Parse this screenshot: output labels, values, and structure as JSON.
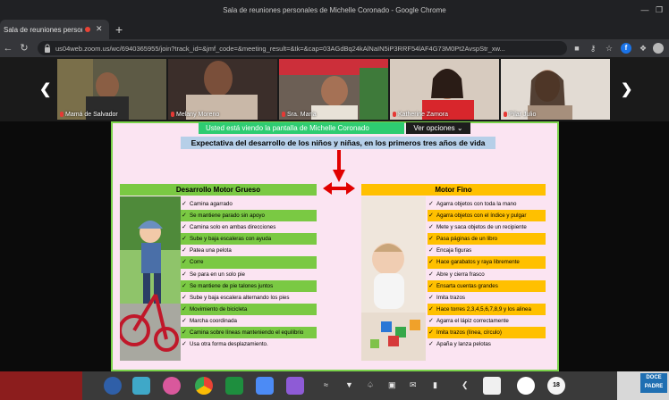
{
  "window": {
    "title": "Sala de reuniones personales de Michelle Coronado - Google Chrome",
    "minimize_icon": "minimize-icon",
    "restore_icon": "restore-icon"
  },
  "tabs": [
    {
      "label": "Sala de reuniones personal",
      "active": true,
      "recording_color": "#ea4335"
    }
  ],
  "new_tab_label": "+",
  "address": {
    "url": "us04web.zoom.us/wc/6940365955/join?track_id=&jmf_code=&meeting_result=&tk=&cap=03AGdBq24kAlNaIN5iP3RRF54lAF4G73M0Pt2AvspStr_xw..."
  },
  "participants": [
    {
      "name": "Mamá de Salvador",
      "muted": true,
      "bg": "#6e6a52"
    },
    {
      "name": "Melany Moreno",
      "muted": true,
      "bg": "#4a3a35"
    },
    {
      "name": "Sra. María",
      "muted": true,
      "bg": "#7a6a5a"
    },
    {
      "name": "Katherine Zamora",
      "muted": true,
      "bg": "#c9b9a8"
    },
    {
      "name": "Pilar Julio",
      "muted": true,
      "bg": "#d7cfc6"
    }
  ],
  "share_banner": {
    "text": "Usted está viendo la pantalla de Michelle Coronado",
    "options_label": "Ver opciones"
  },
  "slide": {
    "title": "Expectativa del desarrollo de los niños y niñas, en los primeros tres años de vida",
    "gross": {
      "heading": "Desarrollo Motor Grueso",
      "color": "#7ac943",
      "items": [
        {
          "text": "Camina agarrado",
          "hl": false
        },
        {
          "text": "Se mantiene parado sin apoyo",
          "hl": true
        },
        {
          "text": "Camina solo en ambas direcciones",
          "hl": false
        },
        {
          "text": "Sube y baja escaleras con ayuda",
          "hl": true
        },
        {
          "text": "Patea una pelota",
          "hl": false
        },
        {
          "text": "Corre",
          "hl": true
        },
        {
          "text": "Se para en un solo pie",
          "hl": false
        },
        {
          "text": "Se mantiene de pie  talones juntos",
          "hl": true
        },
        {
          "text": "Sube y baja escalera alternando los pies",
          "hl": false
        },
        {
          "text": "Movimiento de bicicleta",
          "hl": true
        },
        {
          "text": "Marcha coordinada",
          "hl": false
        },
        {
          "text": "Camina sobre líneas manteniendo el equilibrio",
          "hl": true
        },
        {
          "text": "Usa otra forma desplazamiento.",
          "hl": false
        }
      ]
    },
    "fine": {
      "heading": "Motor Fino",
      "color": "#ffc000",
      "items": [
        {
          "text": "Agarra objetos con toda la mano",
          "hl": false
        },
        {
          "text": "Agarra objetos con el índice y pulgar",
          "hl": true
        },
        {
          "text": "Mete y saca objetos de un recipiente",
          "hl": false
        },
        {
          "text": "Pasa páginas de un libro",
          "hl": true
        },
        {
          "text": "Encaja figuras",
          "hl": false
        },
        {
          "text": "Hace garabatos y raya libremente",
          "hl": true
        },
        {
          "text": "Abre y cierra frasco",
          "hl": false
        },
        {
          "text": "Ensarta cuentas grandes",
          "hl": true
        },
        {
          "text": "Imita trazos",
          "hl": false
        },
        {
          "text": "Hace torres 2,3,4,5,6,7,8,9 y los alinea",
          "hl": true
        },
        {
          "text": "Agarra el lápiz correctamente",
          "hl": false
        },
        {
          "text": "Imita trazos (línea,  círculo)",
          "hl": true
        },
        {
          "text": "Apaña y lanza pelotas",
          "hl": false
        }
      ]
    }
  },
  "taskbar": {
    "apps": [
      "fedora-icon",
      "files-icon",
      "settings-icon",
      "chrome-icon",
      "sheets-icon",
      "software-icon",
      "editor-icon"
    ],
    "tray": [
      "wifi-icon",
      "network-icon",
      "bell-icon",
      "package-icon",
      "chat-icon",
      "battery-icon",
      "chevron-left-icon"
    ],
    "clock_badge": "18",
    "corner_stamp": "DOCE PADRE"
  }
}
